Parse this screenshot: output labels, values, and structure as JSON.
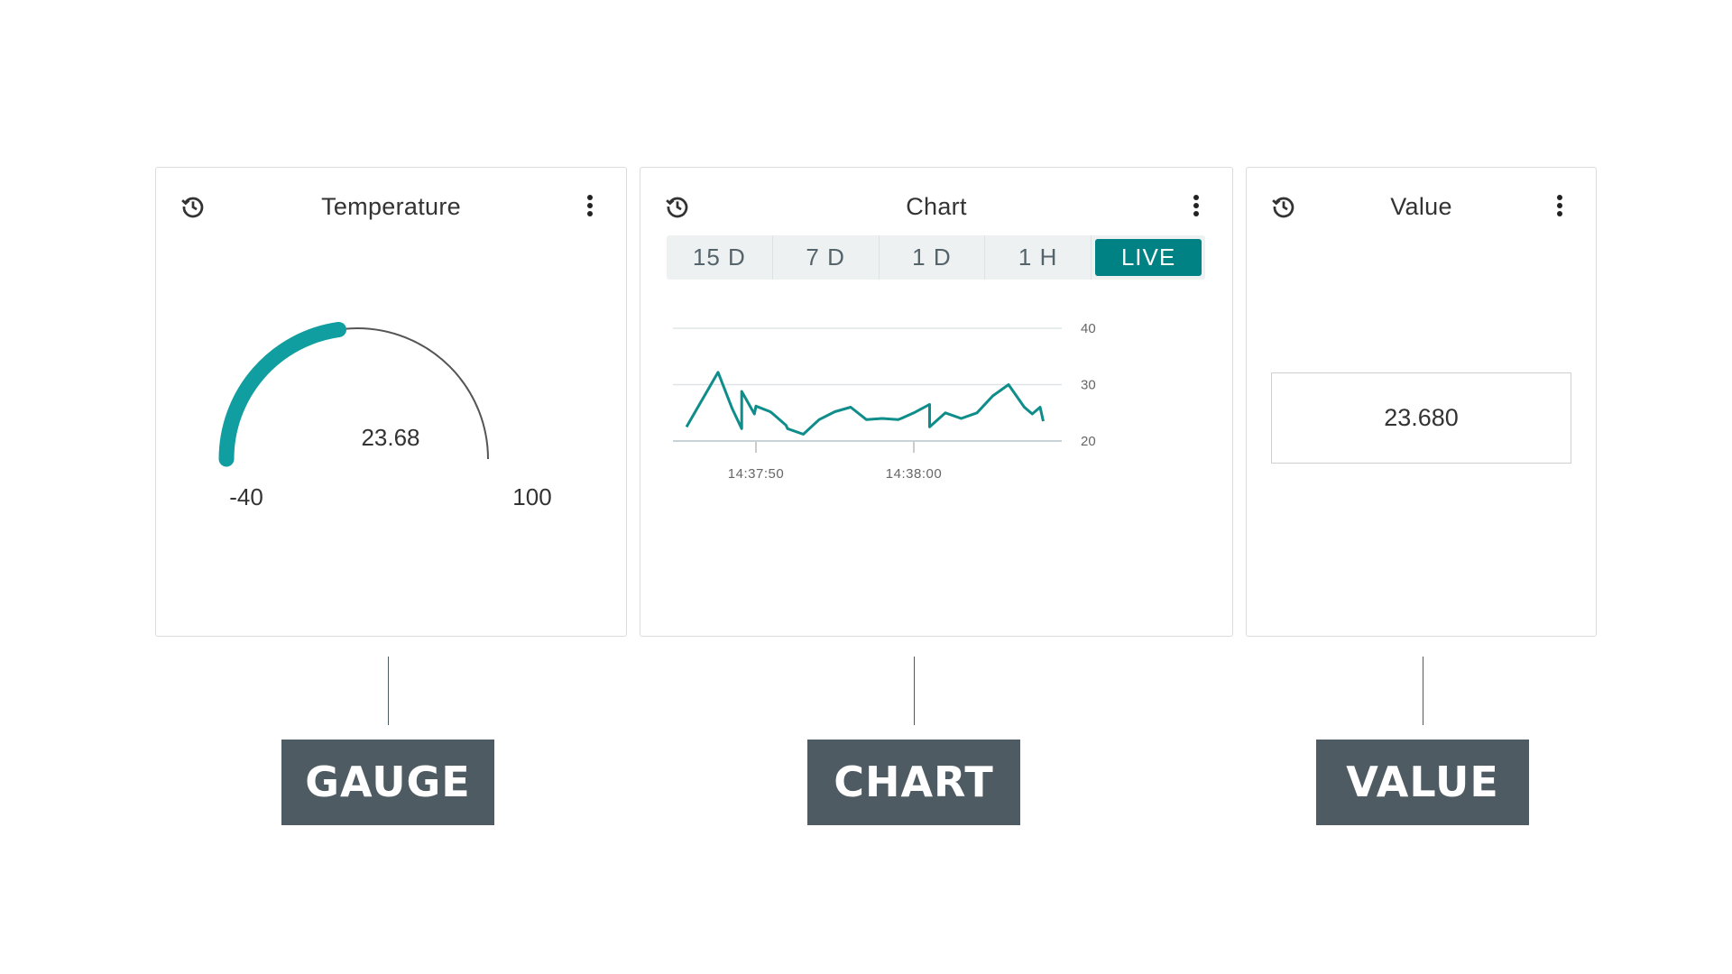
{
  "gauge_widget": {
    "title": "Temperature",
    "value_text": "23.68",
    "min_label": "-40",
    "max_label": "100",
    "min": -40,
    "max": 100,
    "value": 23.68,
    "history_icon": "history-icon",
    "menu_icon": "more-vert-icon"
  },
  "chart_widget": {
    "title": "Chart",
    "tabs": [
      {
        "label": "15 D",
        "active": false
      },
      {
        "label": "7 D",
        "active": false
      },
      {
        "label": "1 D",
        "active": false
      },
      {
        "label": "1 H",
        "active": false
      },
      {
        "label": "LIVE",
        "active": true
      }
    ],
    "history_icon": "history-icon",
    "menu_icon": "more-vert-icon"
  },
  "value_widget": {
    "title": "Value",
    "value_text": "23.680",
    "history_icon": "history-icon",
    "menu_icon": "more-vert-icon"
  },
  "labels": {
    "gauge": "GAUGE",
    "chart": "CHART",
    "value": "VALUE"
  },
  "colors": {
    "accent": "#008184",
    "gauge_fill": "#119ea0",
    "label_bg": "#4f5b62"
  },
  "chart_data": {
    "type": "line",
    "series": [
      {
        "x": [
          "14:37:45.6",
          "14:37:47.6",
          "14:37:48.5",
          "14:37:49.1",
          "14:37:49.1",
          "14:37:49.9",
          "14:37:50.0",
          "14:37:50.9",
          "14:37:51.0",
          "14:37:51.9",
          "14:37:52.0",
          "14:37:53.0",
          "14:37:54.0",
          "14:37:55.0",
          "14:37:56.0",
          "14:37:57.0",
          "14:37:58.0",
          "14:37:59.0",
          "14:37:59.2",
          "14:38:00.0",
          "14:38:01.0",
          "14:38:01.0",
          "14:38:02.0",
          "14:38:03.0",
          "14:38:04.0",
          "14:38:05.0",
          "14:38:06.0",
          "14:38:07.0",
          "14:38:07.5",
          "14:38:08.0",
          "14:38:08.2"
        ],
        "y": [
          22.5,
          32.2,
          25.7,
          22.2,
          28.8,
          24.8,
          26.2,
          25.2,
          25.0,
          22.8,
          22.2,
          21.2,
          23.8,
          25.2,
          26.0,
          23.8,
          24.0,
          23.8,
          24.0,
          25.0,
          26.5,
          22.5,
          25.0,
          24.0,
          25.0,
          28.0,
          30.0,
          26.0,
          24.8,
          26.0,
          23.5
        ]
      }
    ],
    "x_ticks": [
      "14:37:50",
      "14:38:00"
    ],
    "y_ticks": [
      20,
      30,
      40
    ],
    "ylim": [
      20,
      40
    ],
    "grid": true,
    "y_axis_side": "right"
  }
}
